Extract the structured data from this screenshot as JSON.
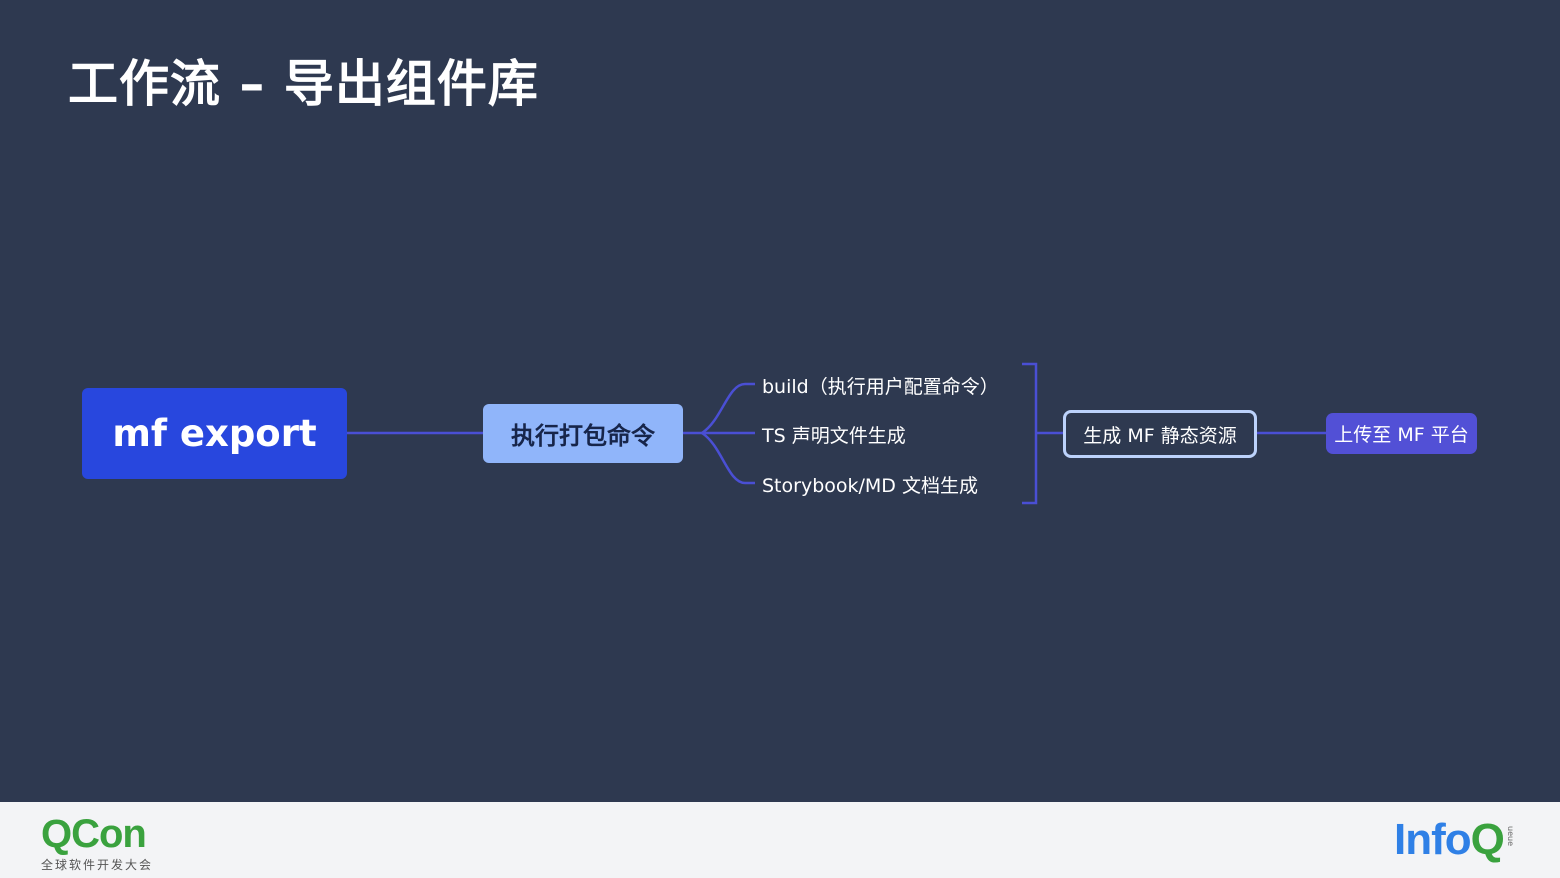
{
  "slide": {
    "title": "工作流 – 导出组件库"
  },
  "diagram": {
    "root": "mf export",
    "step_build": "执行打包命令",
    "branches": [
      "build（执行用户配置命令）",
      "TS 声明文件生成",
      "Storybook/MD 文档生成"
    ],
    "step_assets": "生成 MF 静态资源",
    "step_upload": "上传至 MF 平台"
  },
  "footer": {
    "qcon_logo": "QCon",
    "qcon_subtitle": "全球软件开发大会",
    "infoq_logo": "InfoQ",
    "infoq_side": "ueue"
  },
  "colors": {
    "background": "#2e3950",
    "root_node": "#2847de",
    "build_node": "#90b5fa",
    "upload_node": "#5250d6",
    "connector": "#4a4fd4",
    "qcon_green": "#3aa23e",
    "infoq_blue": "#2f80e6"
  }
}
